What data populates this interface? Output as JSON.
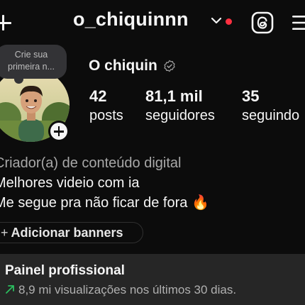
{
  "header": {
    "username": "o_chiquinnn",
    "has_notification": true,
    "accent_color": "#ff3040",
    "icons": [
      "plus-icon",
      "chevron-down-icon",
      "threads-icon",
      "menu-icon"
    ]
  },
  "note": {
    "line1": "Crie sua",
    "line2": "primeira n..."
  },
  "profile": {
    "display_name": "O chiquin",
    "verified_badge": "verified-icon"
  },
  "stats": [
    {
      "value": "42",
      "label": "posts"
    },
    {
      "value": "81,1 mil",
      "label": "seguidores"
    },
    {
      "value": "35",
      "label": "seguindo"
    }
  ],
  "bio": {
    "category": "Criador(a) de conteúdo digital",
    "line1": "Melhores videio com ia",
    "line2": "Me segue pra não ficar de fora 🔥"
  },
  "banners": {
    "label": "Adicionar banners",
    "prefix": "+"
  },
  "panel": {
    "title": "Painel profissional",
    "subtitle": "8,9 mi visualizações nos últimos 30 dias.",
    "trend_color": "#2bbf5f"
  }
}
